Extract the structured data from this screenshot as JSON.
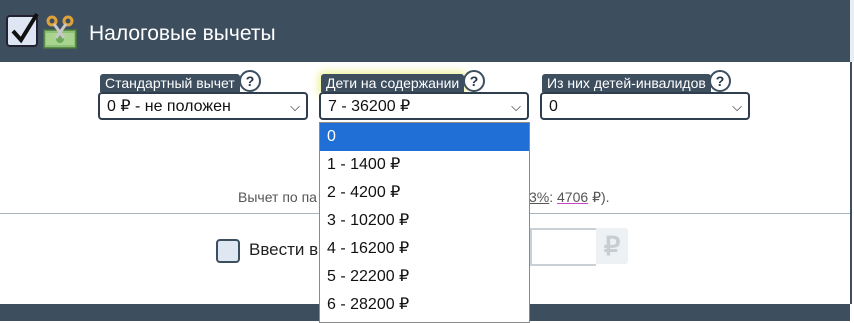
{
  "header": {
    "title": "Налоговые вычеты"
  },
  "fields": {
    "standard": {
      "label": "Стандартный вычет",
      "value": "0 ₽ - не положен"
    },
    "children": {
      "label": "Дети на содержании",
      "value": "7 - 36200 ₽"
    },
    "disabled": {
      "label": "Из них детей-инвалидов",
      "value": "0"
    },
    "help": "?"
  },
  "note": {
    "prefix": "Вычет по па",
    "pct": "3%",
    "sep": ":",
    "amount": "4706",
    "suffix": "₽)."
  },
  "manual": {
    "label": "Ввести в",
    "currency": "₽"
  },
  "dropdown": {
    "options": [
      "0",
      "1 - 1400 ₽",
      "2 - 4200 ₽",
      "3 - 10200 ₽",
      "4 - 16200 ₽",
      "5 - 22200 ₽",
      "6 - 28200 ₽"
    ],
    "highlighted": "0"
  },
  "colors": {
    "header": "#3d4e5f",
    "selection": "#1f6fd6",
    "accent_underline": "#cc44cc"
  },
  "icons": {
    "header_checkbox": "checkbox-checked-icon",
    "tax_icon": "money-scissors-icon",
    "dropdown": "chevron-down-icon"
  }
}
